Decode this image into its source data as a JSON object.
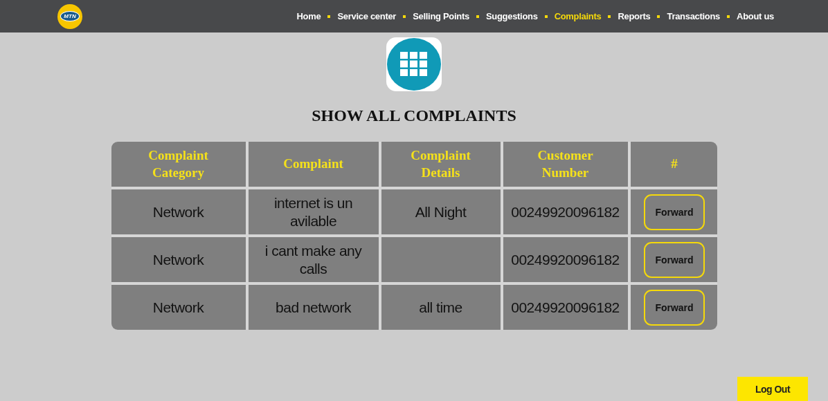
{
  "header": {
    "logo_text": "MTN",
    "nav": [
      {
        "label": "Home",
        "selected": false
      },
      {
        "label": "Service center",
        "selected": false
      },
      {
        "label": "Selling Points",
        "selected": false
      },
      {
        "label": "Suggestions",
        "selected": false
      },
      {
        "label": "Complaints",
        "selected": true
      },
      {
        "label": "Reports",
        "selected": false
      },
      {
        "label": "Transactions",
        "selected": false
      },
      {
        "label": "About us",
        "selected": false
      }
    ]
  },
  "title": "SHOW ALL COMPLAINTS",
  "table": {
    "columns": [
      "Complaint Category",
      "Complaint",
      "Complaint Details",
      "Customer Number",
      "#"
    ],
    "rows": [
      {
        "category": "Network",
        "complaint": "internet is un avilable",
        "details": "All Night",
        "customer_number": "00249920096182",
        "action": "Forward"
      },
      {
        "category": "Network",
        "complaint": "i cant make any calls",
        "customer_number": "00249920096182",
        "action": "Forward"
      },
      {
        "category": "Network",
        "complaint": "bad network",
        "details": "all time",
        "customer_number": "00249920096182",
        "action": "Forward"
      }
    ]
  },
  "logout": "Log Out"
}
